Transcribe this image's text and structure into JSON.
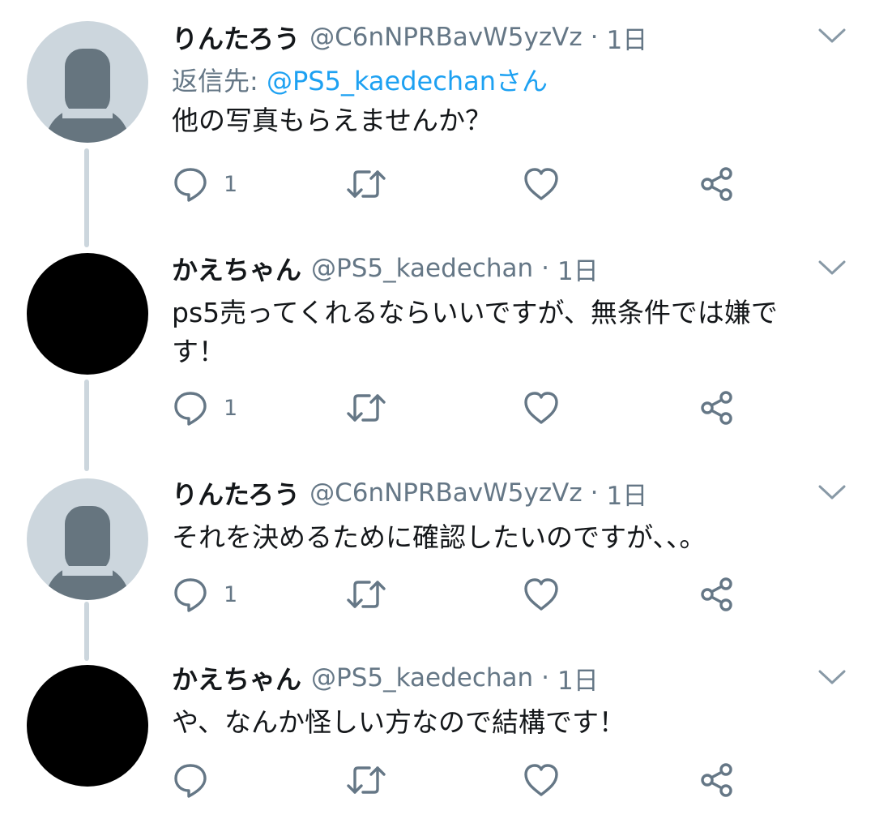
{
  "colors": {
    "connector": "#ccd6dd",
    "handle_gray": "#657786",
    "mention_blue": "#1da1f2",
    "text": "#14171a"
  },
  "tweets": [
    {
      "name": "りんたろう",
      "handle": "@C6nNPRBavW5yzVz",
      "separator": "·",
      "time": "1日",
      "reply_to_label": "返信先: ",
      "reply_to_handle": "@PS5_kaedechanさん",
      "text": "他の写真もらえませんか？",
      "reply_count": "1",
      "avatar": "default-profile-avatar"
    },
    {
      "name": "かえちゃん",
      "handle": "@PS5_kaedechan",
      "separator": "·",
      "time": "1日",
      "text": "ps5売ってくれるならいいですが、無条件では嫌です！",
      "reply_count": "1",
      "avatar": "black-avatar"
    },
    {
      "name": "りんたろう",
      "handle": "@C6nNPRBavW5yzVz",
      "separator": "·",
      "time": "1日",
      "text": "それを決めるために確認したいのですが、、。",
      "reply_count": "1",
      "avatar": "default-profile-avatar"
    },
    {
      "name": "かえちゃん",
      "handle": "@PS5_kaedechan",
      "separator": "·",
      "time": "1日",
      "text": "や、なんか怪しい方なので結構です！",
      "reply_count": "",
      "avatar": "black-avatar"
    }
  ]
}
